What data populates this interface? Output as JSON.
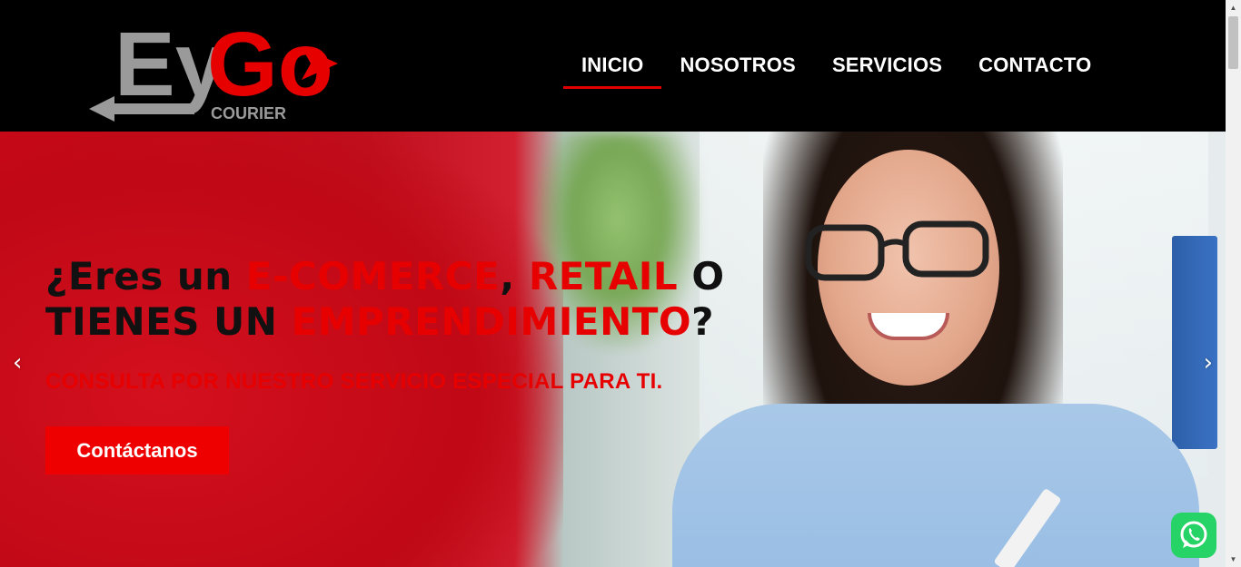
{
  "brand": {
    "logo_text_ey": "Ey",
    "logo_text_go": "Go",
    "logo_subtitle": "COURIER"
  },
  "nav": {
    "items": [
      {
        "label": "INICIO",
        "active": true
      },
      {
        "label": "NOSOTROS",
        "active": false
      },
      {
        "label": "SERVICIOS",
        "active": false
      },
      {
        "label": "CONTACTO",
        "active": false
      }
    ]
  },
  "hero": {
    "headline_part1": "¿Eres un ",
    "headline_red1": "E-COMERCE",
    "headline_part2": ", ",
    "headline_red2": "RETAIL",
    "headline_part3": " O TIENES UN ",
    "headline_red3": "EMPRENDIMIENTO",
    "headline_part4": "?",
    "subline": "CONSULTA POR NUESTRO SERVICIO ESPECIAL PARA TI.",
    "cta_label": "Contáctanos",
    "prev_arrow": "‹",
    "next_arrow": "›"
  },
  "colors": {
    "accent": "#e60000",
    "header_bg": "#000000",
    "whatsapp": "#25d366"
  }
}
